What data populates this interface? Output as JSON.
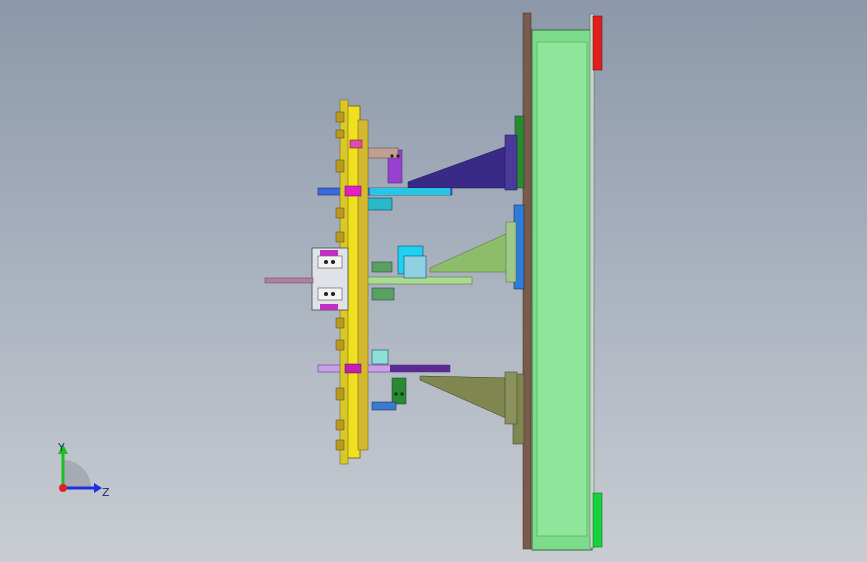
{
  "axes": {
    "y_label": "Y",
    "z_label": "Z"
  },
  "colors": {
    "plate_green": "#7cdc8a",
    "plate_brown": "#7a5a4a",
    "red_block": "#e02020",
    "green_block": "#18d040",
    "fixture_yellow": "#f0e020",
    "navy_support": "#3a2a88",
    "olive_support": "#8da86a",
    "cyan_part": "#20c8f0",
    "magenta_part": "#e020c0",
    "purple_part": "#9a40d0"
  }
}
